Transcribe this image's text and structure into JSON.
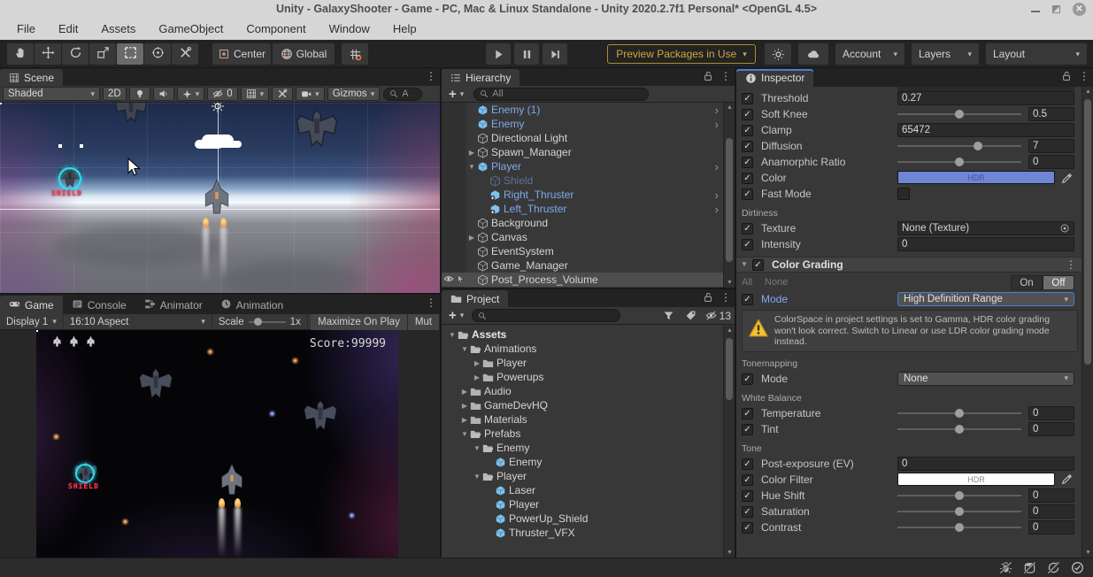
{
  "window": {
    "title": "Unity - GalaxyShooter - Game - PC, Mac & Linux Standalone - Unity 2020.2.7f1 Personal* <OpenGL 4.5>",
    "controls": [
      "minimize",
      "maximize",
      "close"
    ]
  },
  "menubar": {
    "items": [
      "File",
      "Edit",
      "Assets",
      "GameObject",
      "Component",
      "Window",
      "Help"
    ]
  },
  "toolbar": {
    "tools": [
      "hand-tool",
      "move-tool",
      "rotate-tool",
      "scale-tool",
      "rect-tool",
      "transform-tool",
      "custom-tools"
    ],
    "active_tool": "rect-tool",
    "pivot_label": "Center",
    "space_label": "Global",
    "play_controls": [
      "play",
      "pause",
      "step"
    ],
    "preview_label": "Preview Packages in Use",
    "account_label": "Account",
    "layers_label": "Layers",
    "layout_label": "Layout",
    "accent_gold": "#CDA83C"
  },
  "scene": {
    "tab": "Scene",
    "shading_mode": "Shaded",
    "btn_2d": "2D",
    "hidden_count": "0",
    "gizmos_label": "Gizmos",
    "search_text": "A",
    "shield_label": "SHIELD",
    "toolbar_icons": [
      "light-icon",
      "audio-icon",
      "effects-icon",
      "hidden-objects-icon",
      "grid-icon",
      "tools-icon",
      "camera-icon"
    ]
  },
  "game": {
    "tabs": [
      {
        "label": "Game",
        "icon": "gamepad-icon",
        "active": true
      },
      {
        "label": "Console",
        "icon": "console-icon",
        "active": false
      },
      {
        "label": "Animator",
        "icon": "animator-icon",
        "active": false
      },
      {
        "label": "Animation",
        "icon": "clock-icon",
        "active": false
      }
    ],
    "display": "Display 1",
    "aspect": "16:10 Aspect",
    "scale_label": "Scale",
    "scale_value": "1x",
    "maximize_label": "Maximize On Play",
    "mute_label": "Mut",
    "score": "Score:99999",
    "shield_label": "SHIELD",
    "lives": 3
  },
  "hierarchy": {
    "tab": "Hierarchy",
    "search_placeholder": "All",
    "items": [
      {
        "label": "Enemy (1)",
        "kind": "prefab",
        "indent": 1,
        "arrow": true
      },
      {
        "label": "Enemy",
        "kind": "prefab",
        "indent": 1,
        "arrow": true
      },
      {
        "label": "Directional Light",
        "kind": "plain",
        "indent": 1
      },
      {
        "label": "Spawn_Manager",
        "kind": "plain",
        "indent": 1,
        "exp": "closed"
      },
      {
        "label": "Player",
        "kind": "prefab",
        "indent": 1,
        "exp": "open",
        "arrow": true
      },
      {
        "label": "Shield",
        "kind": "disabled",
        "indent": 2
      },
      {
        "label": "Right_Thruster",
        "kind": "prefab-added",
        "indent": 2,
        "arrow": true
      },
      {
        "label": "Left_Thruster",
        "kind": "prefab-added",
        "indent": 2,
        "arrow": true
      },
      {
        "label": "Background",
        "kind": "plain",
        "indent": 1
      },
      {
        "label": "Canvas",
        "kind": "plain",
        "indent": 1,
        "exp": "closed"
      },
      {
        "label": "EventSystem",
        "kind": "plain",
        "indent": 1
      },
      {
        "label": "Game_Manager",
        "kind": "plain",
        "indent": 1
      },
      {
        "label": "Post_Process_Volume",
        "kind": "plain",
        "indent": 1,
        "selected": true,
        "eye": true
      }
    ]
  },
  "project": {
    "tab": "Project",
    "hidden_count": "13",
    "items": [
      {
        "label": "Assets",
        "icon": "folder-open",
        "indent": 0,
        "exp": "open",
        "bold": true
      },
      {
        "label": "Animations",
        "icon": "folder-open",
        "indent": 1,
        "exp": "open"
      },
      {
        "label": "Player",
        "icon": "folder",
        "indent": 2,
        "exp": "closed"
      },
      {
        "label": "Powerups",
        "icon": "folder",
        "indent": 2,
        "exp": "closed"
      },
      {
        "label": "Audio",
        "icon": "folder",
        "indent": 1,
        "exp": "closed"
      },
      {
        "label": "GameDevHQ",
        "icon": "folder",
        "indent": 1,
        "exp": "closed"
      },
      {
        "label": "Materials",
        "icon": "folder",
        "indent": 1,
        "exp": "closed"
      },
      {
        "label": "Prefabs",
        "icon": "folder-open",
        "indent": 1,
        "exp": "open"
      },
      {
        "label": "Enemy",
        "icon": "folder-open",
        "indent": 2,
        "exp": "open"
      },
      {
        "label": "Enemy",
        "icon": "prefab",
        "indent": 3
      },
      {
        "label": "Player",
        "icon": "folder-open",
        "indent": 2,
        "exp": "open"
      },
      {
        "label": "Laser",
        "icon": "prefab",
        "indent": 3
      },
      {
        "label": "Player",
        "icon": "prefab",
        "indent": 3
      },
      {
        "label": "PowerUp_Shield",
        "icon": "prefab",
        "indent": 3
      },
      {
        "label": "Thruster_VFX",
        "icon": "prefab",
        "indent": 3
      }
    ]
  },
  "inspector": {
    "tab": "Inspector",
    "colors": {
      "override_blue": "#7FA9EA",
      "focus_border": "#4A7FD4",
      "hdr_swatch": "#6E86D3",
      "warning_yellow": "#F8C12C"
    },
    "rows": [
      {
        "t": "sliver"
      },
      {
        "t": "prop",
        "label": "Threshold",
        "ctl": "field",
        "value": "0.27"
      },
      {
        "t": "prop",
        "label": "Soft Knee",
        "ctl": "slider",
        "value": "0.5",
        "pos": 50
      },
      {
        "t": "prop",
        "label": "Clamp",
        "ctl": "field",
        "value": "65472"
      },
      {
        "t": "prop",
        "label": "Diffusion",
        "ctl": "slider",
        "value": "7",
        "pos": 65
      },
      {
        "t": "prop",
        "label": "Anamorphic Ratio",
        "ctl": "slider",
        "value": "0",
        "pos": 50
      },
      {
        "t": "prop",
        "label": "Color",
        "ctl": "color",
        "value": "HDR",
        "swatch": "#6E86D3",
        "text_dark": false
      },
      {
        "t": "prop",
        "label": "Fast Mode",
        "ctl": "checkbox"
      },
      {
        "t": "section",
        "label": "Dirtiness"
      },
      {
        "t": "prop",
        "label": "Texture",
        "ctl": "object",
        "value": "None (Texture)"
      },
      {
        "t": "prop",
        "label": "Intensity",
        "ctl": "field",
        "value": "0"
      },
      {
        "t": "header",
        "label": "Color Grading"
      },
      {
        "t": "toggles",
        "left": [
          "All",
          "None"
        ],
        "on": "On",
        "off": "Off",
        "active": "Off"
      },
      {
        "t": "prop",
        "label": "Mode",
        "ctl": "dropdown",
        "value": "High Definition Range",
        "override": true
      },
      {
        "t": "warning",
        "text": "ColorSpace in project settings is set to Gamma, HDR color grading won't look correct. Switch to Linear or use LDR color grading mode instead."
      },
      {
        "t": "section",
        "label": "Tonemapping"
      },
      {
        "t": "prop",
        "label": "Mode",
        "ctl": "dropdown",
        "value": "None"
      },
      {
        "t": "section",
        "label": "White Balance"
      },
      {
        "t": "prop",
        "label": "Temperature",
        "ctl": "slider",
        "value": "0",
        "pos": 50
      },
      {
        "t": "prop",
        "label": "Tint",
        "ctl": "slider",
        "value": "0",
        "pos": 50
      },
      {
        "t": "section",
        "label": "Tone"
      },
      {
        "t": "prop",
        "label": "Post-exposure (EV)",
        "ctl": "field",
        "value": "0"
      },
      {
        "t": "prop",
        "label": "Color Filter",
        "ctl": "color",
        "value": "HDR",
        "swatch": "#FFFFFF",
        "text_dark": true
      },
      {
        "t": "prop",
        "label": "Hue Shift",
        "ctl": "slider",
        "value": "0",
        "pos": 50
      },
      {
        "t": "prop",
        "label": "Saturation",
        "ctl": "slider",
        "value": "0",
        "pos": 50
      },
      {
        "t": "prop",
        "label": "Contrast",
        "ctl": "slider",
        "value": "0",
        "pos": 50
      }
    ]
  },
  "statusbar": {
    "icons": [
      "debug-disabled-icon",
      "cache-disabled-icon",
      "refresh-disabled-icon",
      "status-ok-icon"
    ]
  }
}
